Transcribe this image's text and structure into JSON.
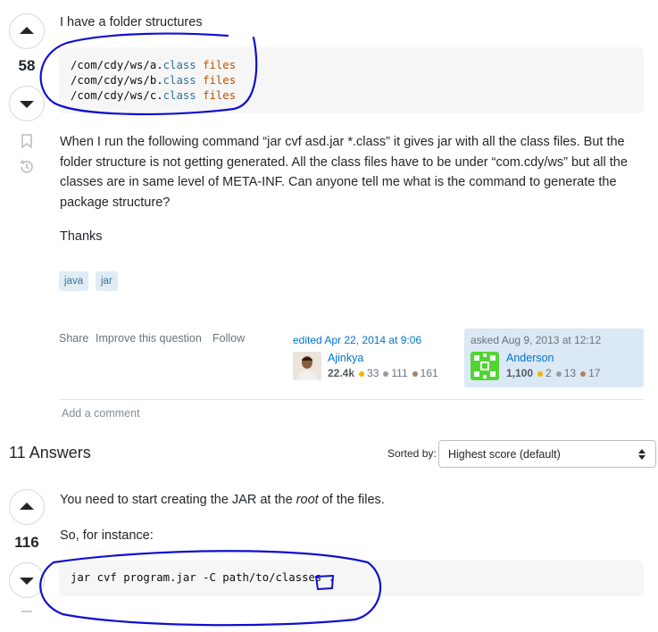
{
  "question": {
    "score": "58",
    "intro": "I have a folder structures",
    "code_lines": [
      {
        "path": "/com/cdy/ws/a.",
        "kw": "class",
        "kw2": "files"
      },
      {
        "path": "/com/cdy/ws/b.",
        "kw": "class",
        "kw2": "files"
      },
      {
        "path": "/com/cdy/ws/c.",
        "kw": "class",
        "kw2": "files"
      }
    ],
    "body": "When I run the following command “jar cvf asd.jar *.class” it gives jar with all the class files. But the folder structure is not getting generated. All the class files have to be under “com.cdy/ws” but all the classes are in same level of META-INF. Can anyone tell me what is the command to generate the package structure?",
    "thanks": "Thanks",
    "tags": [
      "java",
      "jar"
    ],
    "actions": {
      "share": "Share",
      "improve": "Improve this question",
      "follow": "Follow"
    },
    "edited": {
      "label": "edited Apr 22, 2014 at 9:06",
      "user": "Ajinkya",
      "rep": "22.4k",
      "gold": "33",
      "silver": "111",
      "bronze": "161"
    },
    "asked": {
      "label": "asked Aug 9, 2013 at 12:12",
      "user": "Anderson",
      "rep": "1,100",
      "gold": "2",
      "silver": "13",
      "bronze": "17"
    },
    "add_comment": "Add a comment"
  },
  "answers": {
    "title": "11 Answers",
    "sorted_by": "Sorted by:",
    "sort_value": "Highest score (default)"
  },
  "answer": {
    "score": "116",
    "line1_pre": "You need to start creating the JAR at the ",
    "line1_em": "root",
    "line1_post": " of the files.",
    "line2": "So, for instance:",
    "code": "jar cvf program.jar -C path/to/classes ."
  },
  "colors": {
    "annotation_ink": "#1010d0",
    "link": "#0074cc",
    "tag_bg": "#e1ecf4"
  },
  "icons": [
    "upvote-arrow-icon",
    "downvote-arrow-icon",
    "bookmark-icon",
    "history-icon",
    "sort-updown-icon"
  ]
}
